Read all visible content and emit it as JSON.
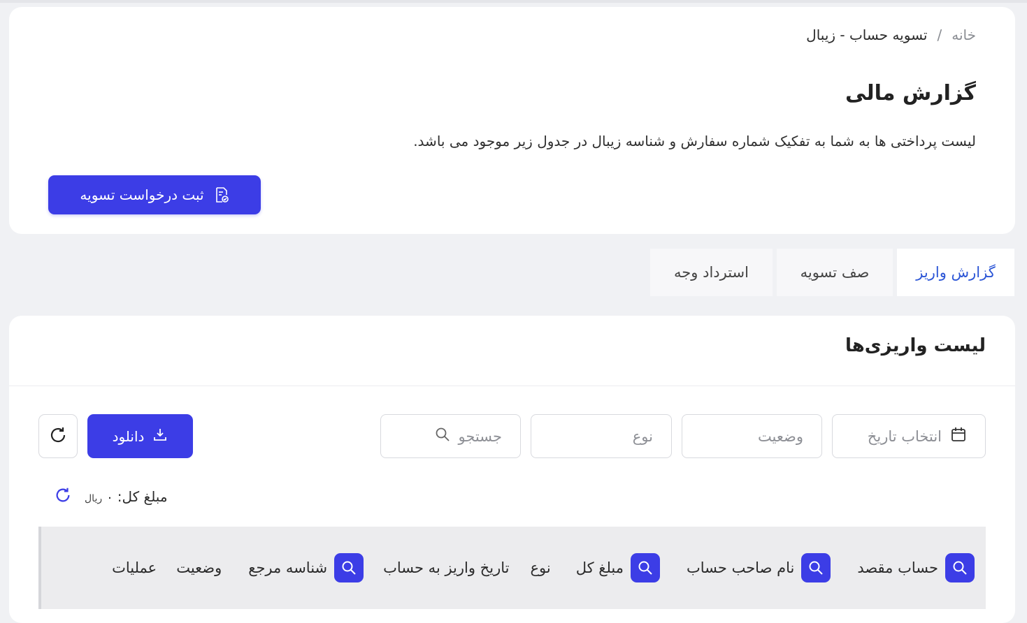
{
  "breadcrumb": {
    "home": "خانه",
    "separator": "/",
    "current": "تسویه حساب - زیبال"
  },
  "page": {
    "title": "گزارش مالی",
    "description": "لیست پرداختی ها به شما به تفکیک شماره سفارش و شناسه زیبال در جدول زیر موجود می باشد.",
    "settlement_button": "ثبت درخواست تسویه"
  },
  "tabs": [
    {
      "label": "گزارش واریز",
      "active": true
    },
    {
      "label": "صف تسویه",
      "active": false
    },
    {
      "label": "استرداد وجه",
      "active": false
    }
  ],
  "list": {
    "title": "لیست واریزی‌ها",
    "filters": {
      "date_placeholder": "انتخاب تاریخ",
      "status_placeholder": "وضعیت",
      "type_placeholder": "نوع",
      "search_placeholder": "جستجو"
    },
    "download_label": "دانلود",
    "total_label": "مبلغ کل:",
    "total_value": "۰",
    "total_unit": "ریال",
    "columns": {
      "dest": "حساب مقصد",
      "owner": "نام صاحب حساب",
      "total": "مبلغ کل",
      "type": "نوع",
      "date": "تاریخ واریز به حساب",
      "ref": "شناسه مرجع",
      "status": "وضعیت",
      "actions": "عملیات"
    }
  },
  "colors": {
    "primary": "#3c3de6",
    "active_tab": "#2b55d6",
    "background": "#f0f1f4"
  },
  "icons": [
    "document-check-icon",
    "calendar-icon",
    "search-icon",
    "download-icon",
    "refresh-icon"
  ]
}
